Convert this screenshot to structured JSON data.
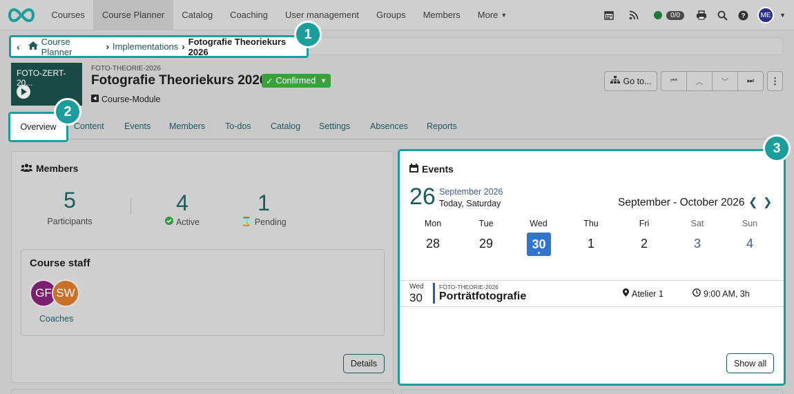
{
  "nav": {
    "items": [
      "Courses",
      "Course Planner",
      "Catalog",
      "Coaching",
      "User management",
      "Groups",
      "Members",
      "More"
    ],
    "active": "Course Planner",
    "badge": "0/0",
    "user_initials": "ME"
  },
  "breadcrumb": {
    "items": [
      "Course Planner",
      "Implementations"
    ],
    "current": "Fotografie Theoriekurs 2026"
  },
  "course": {
    "thumb_label": "FOTO-ZERT-20...",
    "ext_ref": "FOTO-THEORIE-2026",
    "title": "Fotografie Theoriekurs 2026",
    "status": "Confirmed",
    "type": "Course-Module",
    "goto_label": "Go to..."
  },
  "tabs": [
    "Overview",
    "Content",
    "Events",
    "Members",
    "To-dos",
    "Catalog",
    "Settings",
    "Absences",
    "Reports"
  ],
  "members": {
    "title": "Members",
    "participants": "5",
    "participants_label": "Participants",
    "active": "4",
    "active_label": "Active",
    "pending": "1",
    "pending_label": "Pending",
    "staff_title": "Course staff",
    "avatars": [
      "GF",
      "SW"
    ],
    "coaches_label": "Coaches",
    "details_label": "Details"
  },
  "events": {
    "title": "Events",
    "today_num": "26",
    "today_month": "September 2026",
    "today_day": "Today, Saturday",
    "range": "September - October 2026",
    "weekdays": [
      "Mon",
      "Tue",
      "Wed",
      "Thu",
      "Fri",
      "Sat",
      "Sun"
    ],
    "days": [
      "28",
      "29",
      "30",
      "1",
      "2",
      "3",
      "4"
    ],
    "event": {
      "wd": "Wed",
      "dn": "30",
      "ref": "FOTO-THEORIE-2026",
      "title": "Porträtfotografie",
      "location": "Atelier 1",
      "time": "9:00 AM, 3h"
    },
    "show_all": "Show all"
  },
  "callouts": [
    "1",
    "2",
    "3"
  ],
  "colors": {
    "accent": "#1a9d9b",
    "brand": "#1c5a5c",
    "confirmed": "#35a33a",
    "selected_day": "#2f74d0"
  }
}
